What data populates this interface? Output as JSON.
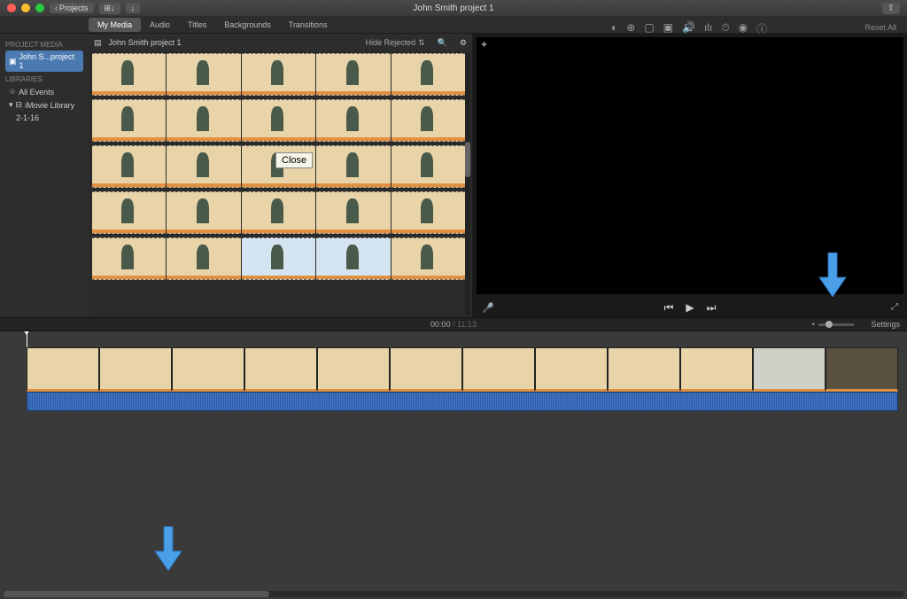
{
  "titlebar": {
    "back_label": "Projects",
    "title": "John Smith project 1"
  },
  "tabs": {
    "my_media": "My Media",
    "audio": "Audio",
    "titles": "Titles",
    "backgrounds": "Backgrounds",
    "transitions": "Transitions"
  },
  "preview_toolbar": {
    "reset_all": "Reset All"
  },
  "sidebar": {
    "project_media_hdr": "PROJECT MEDIA",
    "project_item": "John S...project 1",
    "libraries_hdr": "LIBRARIES",
    "all_events": "All Events",
    "library": "iMovie Library",
    "date_item": "2-1-16"
  },
  "browser": {
    "project_name": "John Smith project 1",
    "hide_rejected": "Hide Rejected"
  },
  "tooltip": {
    "text": "Close"
  },
  "timeline": {
    "current": "00:00",
    "sep": " / ",
    "duration": "11:13",
    "settings": "Settings"
  },
  "colors": {
    "thumb_bg": "#e8d4a8",
    "accent": "#e09040",
    "audio": "#2f5fa8",
    "arrow": "#4aa0e8"
  }
}
